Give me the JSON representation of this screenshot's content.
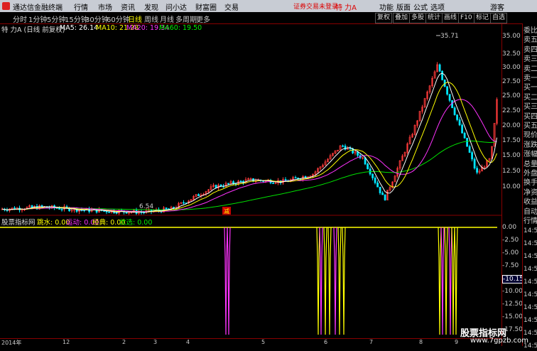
{
  "title_bar": {
    "app_name": "通达信金融终端",
    "menus": [
      "行情",
      "市场",
      "资讯",
      "发现",
      "问小达",
      "财富圈",
      "交易"
    ],
    "status": "证券交易未登录",
    "stock": "特 力A",
    "right_menus": [
      "功能",
      "版面",
      "公式",
      "选项"
    ],
    "user": "游客"
  },
  "toolbar": {
    "periods": [
      "分时",
      "1分钟",
      "5分钟",
      "15分钟",
      "30分钟",
      "60分钟",
      "日线",
      "周线",
      "月线",
      "多周期",
      "更多"
    ],
    "active": "日线",
    "right_tools": [
      "复权",
      "叠加",
      "多股",
      "统计",
      "画线",
      "F10",
      "标记",
      "自选"
    ]
  },
  "legend": {
    "name": "特 力A (日线 前复权)",
    "ma5": "MA5: 26.14",
    "ma10": "MA10: 21.28",
    "ma20": "MA20: 19.34",
    "ma60": "MA60: 19.50"
  },
  "indicator_legend": {
    "name": "股票指标网",
    "tiaoshui": "跳水: 0.00",
    "yundong": "运动: 0.00",
    "jingdian": "经典: 0.00",
    "youxuan": "优选: 0.00"
  },
  "annotations": {
    "high": "35.71",
    "low": "6.54",
    "marker": "减"
  },
  "price_axis": [
    "35.00",
    "32.50",
    "30.00",
    "27.50",
    "25.00",
    "22.50",
    "20.00",
    "17.50",
    "15.00",
    "12.50",
    "10.00"
  ],
  "ind_axis": [
    "0.00",
    "-2.50",
    "-5.00",
    "-7.50",
    "-10.00",
    "-12.50",
    "-15.00",
    "-17.50"
  ],
  "ind_current": "-10.15",
  "x_axis": [
    "2014年",
    "12",
    "2",
    "3",
    "4",
    "5",
    "6",
    "7",
    "8",
    "9"
  ],
  "right_panel": [
    "委比",
    "卖五",
    "卖四",
    "卖三",
    "卖二",
    "卖一",
    "买一",
    "买二",
    "买三",
    "买四",
    "买五",
    "现价",
    "涨跌",
    "涨幅",
    "总量",
    "外盘",
    "换手",
    "净资",
    "收益",
    "自动",
    "行情"
  ],
  "right_times": [
    "14:5",
    "14:5",
    "14:5",
    "14:5",
    "14:5",
    "14:5",
    "14:5",
    "14:5",
    "14:5",
    "14:5"
  ],
  "watermark": "股票指标网",
  "watermark_url": "www.7gpzb.com",
  "colors": {
    "up": "#ff3a3a",
    "down": "#00e5ff",
    "ma5": "#ffffff",
    "ma10": "#ffff00",
    "ma20": "#ff33ff",
    "ma60": "#00e000",
    "ind_yellow": "#ffff00",
    "ind_magenta": "#ff33ff"
  }
}
